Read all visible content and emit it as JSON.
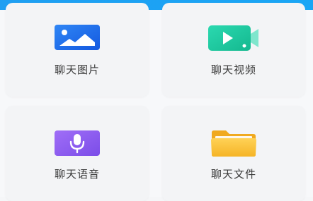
{
  "colors": {
    "header": "#1f9ff2",
    "card_bg": "#f3f4f6",
    "label": "#3a3a3a",
    "picture_icon": "#1a6fe8",
    "video_icon": "#19c9a0",
    "voice_icon": "#8b5cf0",
    "file_icon": "#f6b72a"
  },
  "menu": {
    "items": [
      {
        "label": "聊天图片",
        "icon": "image-icon"
      },
      {
        "label": "聊天视频",
        "icon": "video-icon"
      },
      {
        "label": "聊天语音",
        "icon": "microphone-icon"
      },
      {
        "label": "聊天文件",
        "icon": "folder-icon"
      }
    ]
  }
}
